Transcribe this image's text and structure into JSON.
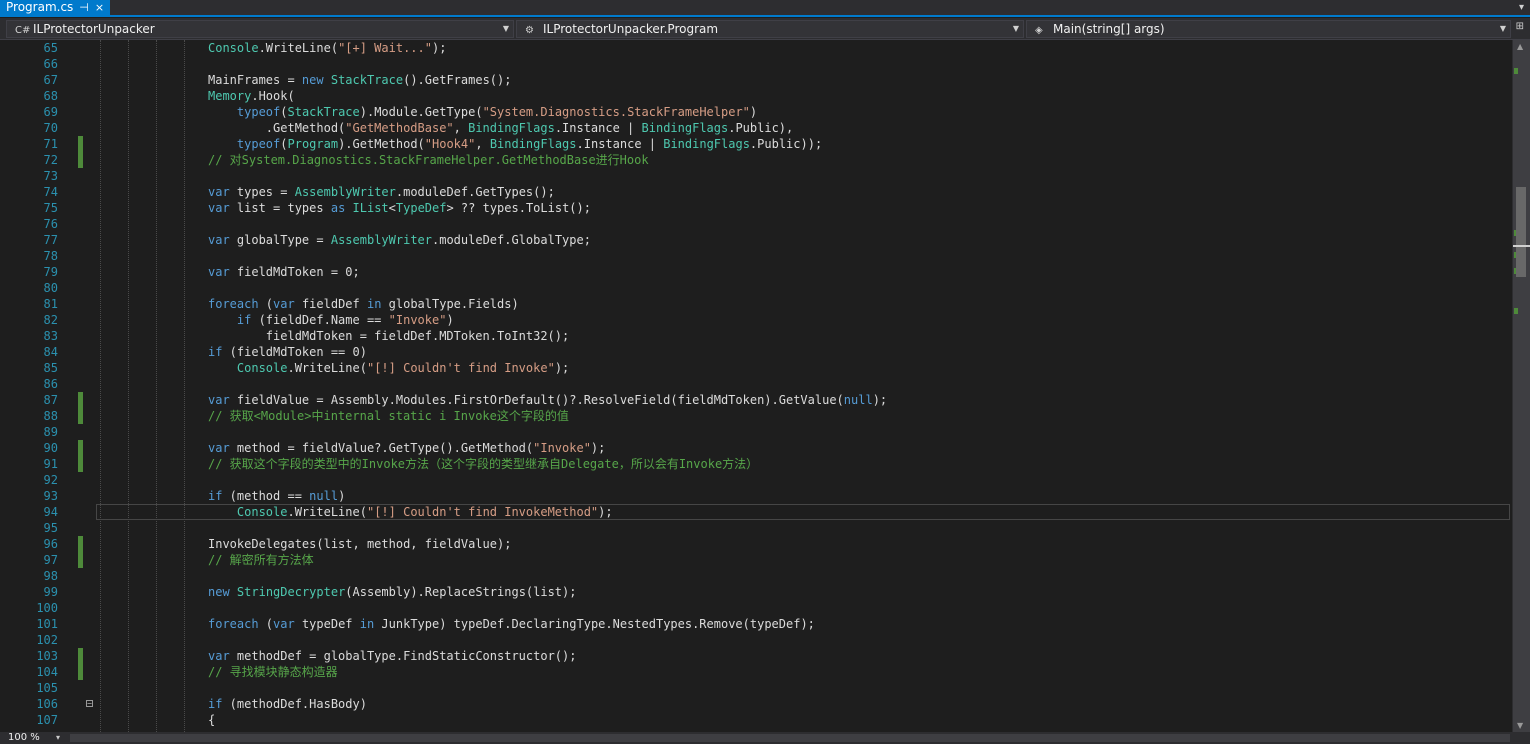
{
  "tab": {
    "title": "Program.cs",
    "pin": "⊣",
    "close": "×",
    "menu": "▾"
  },
  "nav": {
    "project": "ILProtectorUnpacker",
    "class": "ILProtectorUnpacker.Program",
    "member": "Main(string[] args)",
    "project_icon": "C#",
    "class_icon": "⚙",
    "member_icon": "◈",
    "dropdown": "▼",
    "split": "⊞"
  },
  "editor": {
    "lines": [
      {
        "n": "65",
        "c": false,
        "html": "<span class=\"ty\">Console</span>.WriteLine(<span class=\"st\">\"[+] Wait...\"</span>);"
      },
      {
        "n": "66",
        "c": false,
        "html": ""
      },
      {
        "n": "67",
        "c": false,
        "html": "MainFrames = <span class=\"kw\">new</span> <span class=\"ty\">StackTrace</span>().GetFrames();"
      },
      {
        "n": "68",
        "c": false,
        "html": "<span class=\"ty\">Memory</span>.Hook("
      },
      {
        "n": "69",
        "c": false,
        "html": "    <span class=\"kw\">typeof</span>(<span class=\"ty\">StackTrace</span>).Module.GetType(<span class=\"st\">\"System.Diagnostics.StackFrameHelper\"</span>)"
      },
      {
        "n": "70",
        "c": false,
        "html": "        .GetMethod(<span class=\"st\">\"GetMethodBase\"</span>, <span class=\"ty\">BindingFlags</span>.Instance | <span class=\"ty\">BindingFlags</span>.Public),"
      },
      {
        "n": "71",
        "c": true,
        "html": "    <span class=\"kw\">typeof</span>(<span class=\"ty\">Program</span>).GetMethod(<span class=\"st\">\"Hook4\"</span>, <span class=\"ty\">BindingFlags</span>.Instance | <span class=\"ty\">BindingFlags</span>.Public));"
      },
      {
        "n": "72",
        "c": true,
        "html": "<span class=\"cm\">// 对System.Diagnostics.StackFrameHelper.GetMethodBase进行Hook</span>"
      },
      {
        "n": "73",
        "c": false,
        "html": ""
      },
      {
        "n": "74",
        "c": false,
        "html": "<span class=\"kw\">var</span> types = <span class=\"ty\">AssemblyWriter</span>.moduleDef.GetTypes();"
      },
      {
        "n": "75",
        "c": false,
        "html": "<span class=\"kw\">var</span> list = types <span class=\"kw\">as</span> <span class=\"ty\">IList</span>&lt;<span class=\"ty\">TypeDef</span>&gt; ?? types.ToList();"
      },
      {
        "n": "76",
        "c": false,
        "html": ""
      },
      {
        "n": "77",
        "c": false,
        "html": "<span class=\"kw\">var</span> globalType = <span class=\"ty\">AssemblyWriter</span>.moduleDef.GlobalType;"
      },
      {
        "n": "78",
        "c": false,
        "html": ""
      },
      {
        "n": "79",
        "c": false,
        "html": "<span class=\"kw\">var</span> fieldMdToken = 0;"
      },
      {
        "n": "80",
        "c": false,
        "html": ""
      },
      {
        "n": "81",
        "c": false,
        "html": "<span class=\"kw\">foreach</span> (<span class=\"kw\">var</span> fieldDef <span class=\"kw\">in</span> globalType.Fields)"
      },
      {
        "n": "82",
        "c": false,
        "html": "    <span class=\"kw\">if</span> (fieldDef.Name == <span class=\"st\">\"Invoke\"</span>)"
      },
      {
        "n": "83",
        "c": false,
        "html": "        fieldMdToken = fieldDef.MDToken.ToInt32();"
      },
      {
        "n": "84",
        "c": false,
        "html": "<span class=\"kw\">if</span> (fieldMdToken == 0)"
      },
      {
        "n": "85",
        "c": false,
        "html": "    <span class=\"ty\">Console</span>.WriteLine(<span class=\"st\">\"[!] Couldn't find Invoke\"</span>);"
      },
      {
        "n": "86",
        "c": false,
        "html": ""
      },
      {
        "n": "87",
        "c": true,
        "html": "<span class=\"kw\">var</span> fieldValue = Assembly.Modules.FirstOrDefault()?.ResolveField(fieldMdToken).GetValue(<span class=\"kw\">null</span>);"
      },
      {
        "n": "88",
        "c": true,
        "html": "<span class=\"cm\">// 获取&lt;Module&gt;中internal static i Invoke这个字段的值</span>"
      },
      {
        "n": "89",
        "c": false,
        "html": ""
      },
      {
        "n": "90",
        "c": true,
        "html": "<span class=\"kw\">var</span> method = fieldValue?.GetType().GetMethod(<span class=\"st\">\"Invoke\"</span>);"
      },
      {
        "n": "91",
        "c": true,
        "html": "<span class=\"cm\">// 获取这个字段的类型中的Invoke方法（这个字段的类型继承自Delegate，所以会有Invoke方法）</span>"
      },
      {
        "n": "92",
        "c": false,
        "html": ""
      },
      {
        "n": "93",
        "c": false,
        "html": "<span class=\"kw\">if</span> (method == <span class=\"kw\">null</span>)"
      },
      {
        "n": "94",
        "c": false,
        "html": "    <span class=\"ty\">Console</span>.WriteLine(<span class=\"st\">\"[!] Couldn't find InvokeMethod\"</span>);"
      },
      {
        "n": "95",
        "c": false,
        "html": ""
      },
      {
        "n": "96",
        "c": true,
        "html": "InvokeDelegates(list, method, fieldValue);"
      },
      {
        "n": "97",
        "c": true,
        "html": "<span class=\"cm\">// 解密所有方法体</span>"
      },
      {
        "n": "98",
        "c": false,
        "html": ""
      },
      {
        "n": "99",
        "c": false,
        "html": "<span class=\"kw\">new</span> <span class=\"ty\">StringDecrypter</span>(Assembly).ReplaceStrings(list);"
      },
      {
        "n": "100",
        "c": false,
        "html": ""
      },
      {
        "n": "101",
        "c": false,
        "html": "<span class=\"kw\">foreach</span> (<span class=\"kw\">var</span> typeDef <span class=\"kw\">in</span> JunkType) typeDef.DeclaringType.NestedTypes.Remove(typeDef);"
      },
      {
        "n": "102",
        "c": false,
        "html": ""
      },
      {
        "n": "103",
        "c": true,
        "html": "<span class=\"kw\">var</span> methodDef = globalType.FindStaticConstructor();"
      },
      {
        "n": "104",
        "c": true,
        "html": "<span class=\"cm\">// 寻找模块静态构造器</span>"
      },
      {
        "n": "105",
        "c": false,
        "html": ""
      },
      {
        "n": "106",
        "c": false,
        "html": "<span class=\"kw\">if</span> (methodDef.HasBody)"
      },
      {
        "n": "107",
        "c": false,
        "html": "{"
      }
    ]
  },
  "status": {
    "zoom": "100 %",
    "zoom_dd": "▾"
  },
  "scroll": {
    "up": "▲",
    "down": "▼"
  }
}
